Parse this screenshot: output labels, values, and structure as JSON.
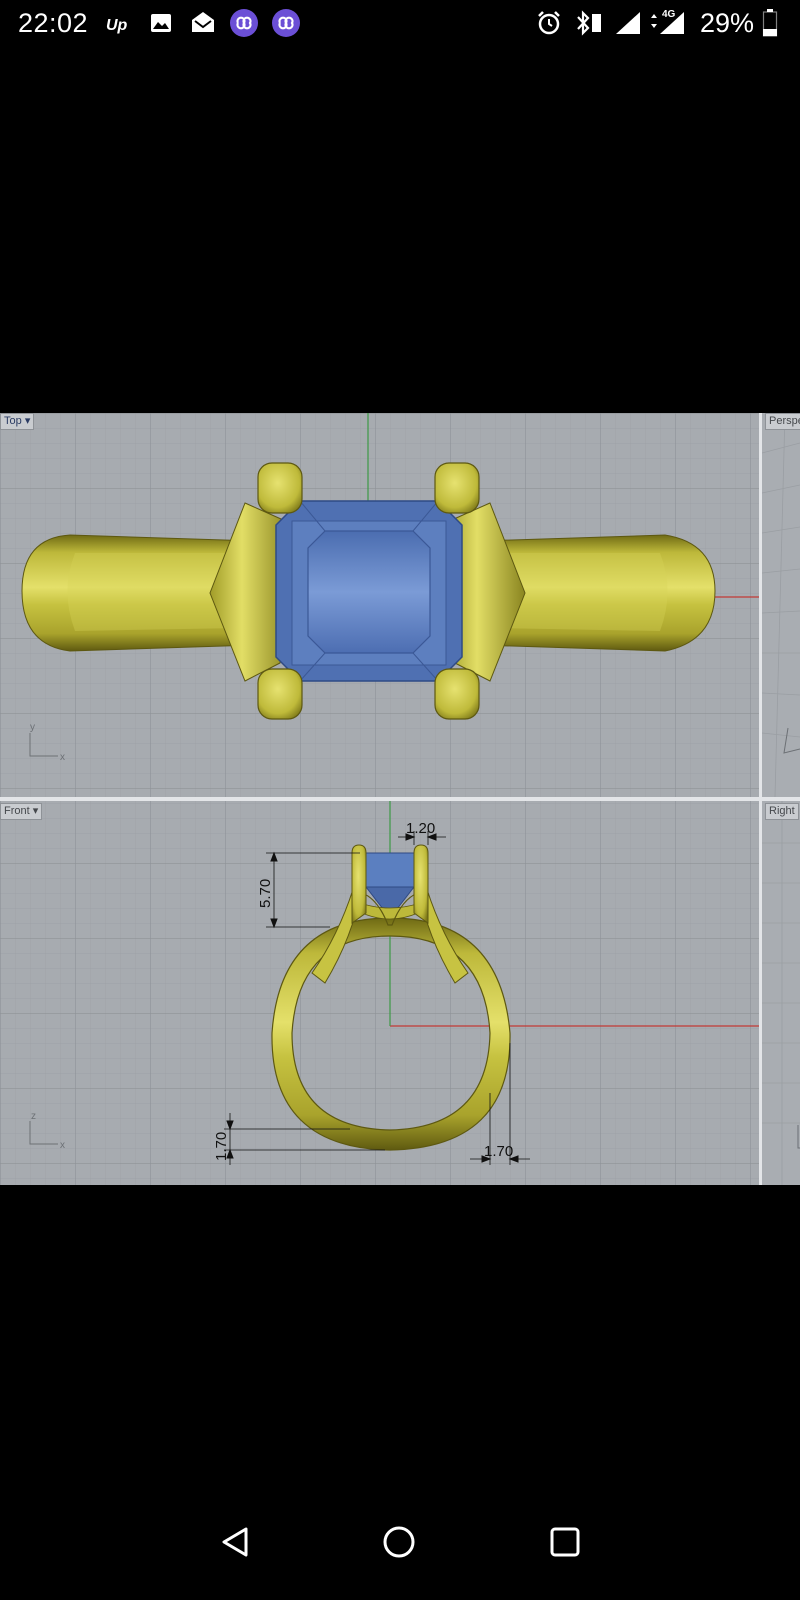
{
  "status_bar": {
    "time": "22:02",
    "notification_icons": [
      "up-icon",
      "image-icon",
      "mail-open-icon",
      "link-app-icon",
      "link-app-icon"
    ],
    "system_icons": [
      "alarm-icon",
      "bluetooth-icon",
      "signal-icon",
      "signal-4g-icon"
    ],
    "network_label": "4G",
    "battery_percent": "29%",
    "battery_level": 0.29
  },
  "viewports": {
    "top": {
      "label": "Top"
    },
    "perspective": {
      "label": "Perspe"
    },
    "front": {
      "label": "Front"
    },
    "right": {
      "label": "Right"
    }
  },
  "axes": {
    "x": "x",
    "y": "y",
    "z": "z"
  },
  "dimensions": {
    "prong_width": "1.20",
    "head_height": "5.70",
    "band_thickness": "1.70",
    "band_width": "1.70"
  },
  "colors": {
    "viewport_bg": "#a7abb0",
    "grid": "#9a9ea3",
    "gold": "#c9c63c",
    "gem": "#5b7fc0",
    "x_axis": "#c23a35",
    "y_axis": "#3d9a45"
  },
  "nav_bar": {
    "back": "back-icon",
    "home": "home-icon",
    "recents": "recents-icon"
  }
}
